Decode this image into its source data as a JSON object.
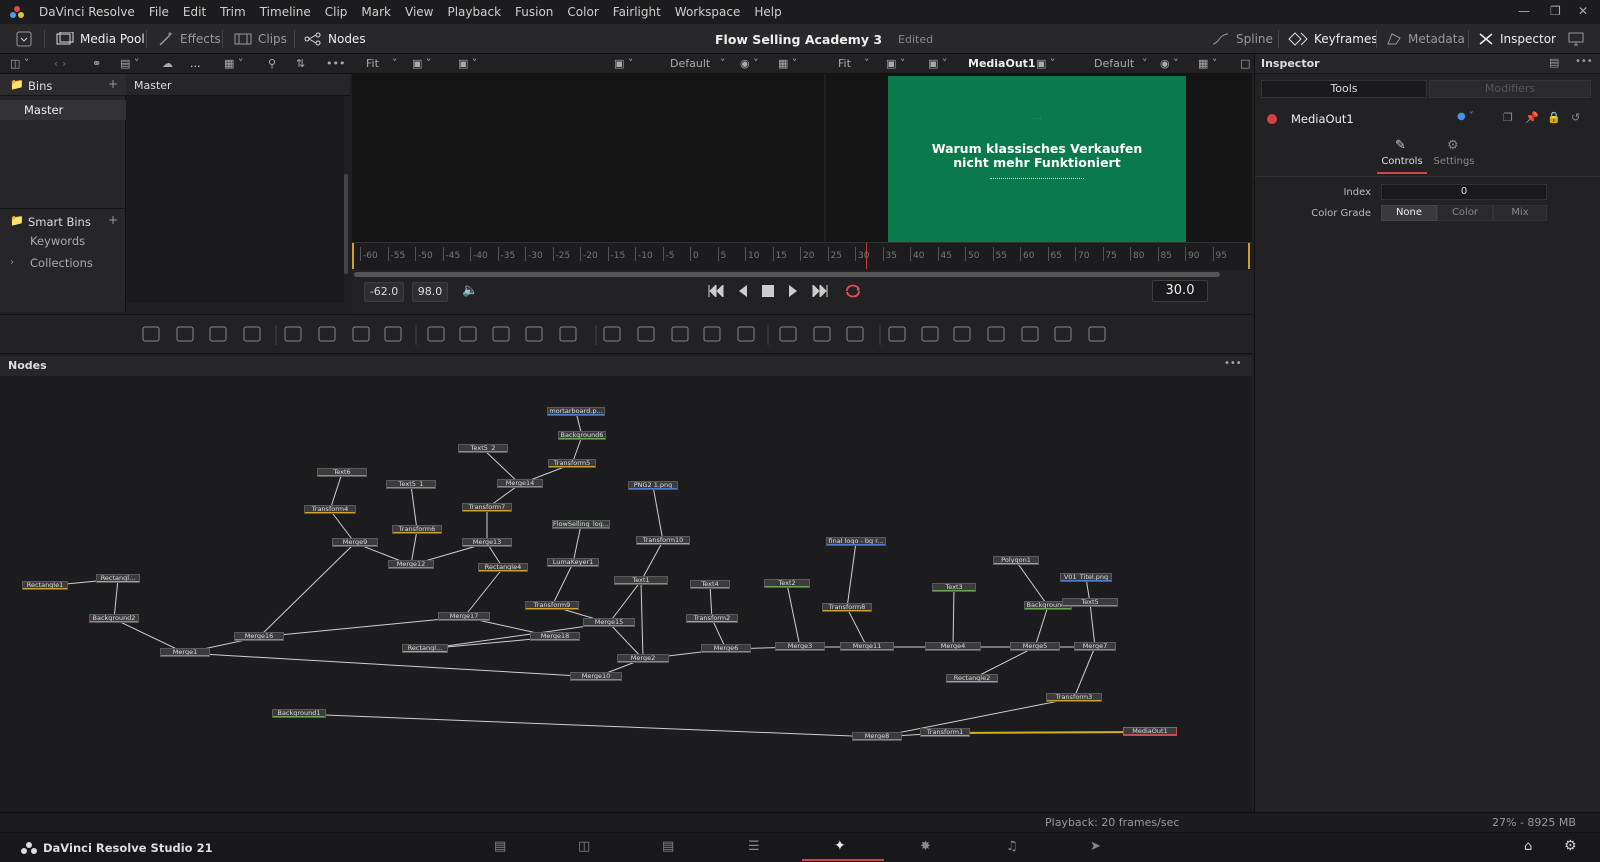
{
  "app": {
    "name": "DaVinci Resolve",
    "brand": "DaVinci Resolve Studio 21"
  },
  "menu": [
    "File",
    "Edit",
    "Trim",
    "Timeline",
    "Clip",
    "Mark",
    "View",
    "Playback",
    "Fusion",
    "Color",
    "Fairlight",
    "Workspace",
    "Help"
  ],
  "toolbar": {
    "media_pool": "Media Pool",
    "effects": "Effects",
    "clips": "Clips",
    "nodes": "Nodes",
    "project_title": "Flow Selling Academy 3",
    "project_status": "Edited",
    "spline": "Spline",
    "keyframes": "Keyframes",
    "metadata": "Metadata",
    "inspector": "Inspector"
  },
  "subbar": {
    "more": "...",
    "fit_left": "Fit",
    "default_left": "Default",
    "fit_right": "Fit",
    "viewer_name": "MediaOut1",
    "default_right": "Default"
  },
  "bins": {
    "title": "Bins",
    "master": "Master",
    "smart_bins": "Smart Bins",
    "keywords": "Keywords",
    "collections": "Collections",
    "pool_header": "Master"
  },
  "viewer": {
    "title_line1": "Warum klassisches Verkaufen",
    "title_line2": "nicht mehr Funktioniert",
    "accent": "#0b7a4b"
  },
  "ruler": {
    "ticks": [
      "-60",
      "-55",
      "-50",
      "-45",
      "-40",
      "-35",
      "-30",
      "-25",
      "-20",
      "-15",
      "-10",
      "-5",
      "0",
      "5",
      "10",
      "15",
      "20",
      "25",
      "30",
      "35",
      "40",
      "45",
      "50",
      "55",
      "60",
      "65",
      "70",
      "75",
      "80",
      "85",
      "90",
      "95"
    ]
  },
  "transport": {
    "start": "-62.0",
    "end": "98.0",
    "current": "30.0"
  },
  "nodes": {
    "header": "Nodes",
    "more": "•••",
    "list": [
      {
        "label": "mortarboard.p...",
        "bar": "#4a7fd0"
      },
      {
        "label": "Background6",
        "bar": "#6aa84f"
      },
      {
        "label": "Text5_2",
        "bar": "#6aa84f"
      },
      {
        "label": "Transform5",
        "bar": "#d4a030"
      },
      {
        "label": "Merge14",
        "bar": "#888888"
      },
      {
        "label": "Text6",
        "bar": "#6aa84f"
      },
      {
        "label": "Text5_1",
        "bar": "#6aa84f"
      },
      {
        "label": "Transform7",
        "bar": "#d4a030"
      },
      {
        "label": "PNG2 1.png",
        "bar": "#4a7fd0"
      },
      {
        "label": "Transform4",
        "bar": "#d4a030"
      },
      {
        "label": "Transform6",
        "bar": "#d4a030"
      },
      {
        "label": "FlowSelling_log...",
        "bar": "#4a7fd0"
      },
      {
        "label": "Merge9",
        "bar": "#888888"
      },
      {
        "label": "Merge13",
        "bar": "#888888"
      },
      {
        "label": "Transform10",
        "bar": "#d4a030"
      },
      {
        "label": "final logo - bg r...",
        "bar": "#4a7fd0"
      },
      {
        "label": "Merge12",
        "bar": "#888888"
      },
      {
        "label": "Rectangle4",
        "bar": "#d4a030"
      },
      {
        "label": "LumaKeyer1",
        "bar": "#6aa84f"
      },
      {
        "label": "Polygon1",
        "bar": "#d4a030"
      },
      {
        "label": "Rectangle1",
        "bar": "#d4a030"
      },
      {
        "label": "Rectangl...",
        "bar": "#d4a030"
      },
      {
        "label": "Text1",
        "bar": "#6aa84f"
      },
      {
        "label": "Text4",
        "bar": "#6aa84f"
      },
      {
        "label": "Text2",
        "bar": "#6aa84f"
      },
      {
        "label": "Text3",
        "bar": "#6aa84f"
      },
      {
        "label": "V01_Titel.png",
        "bar": "#4a7fd0"
      },
      {
        "label": "Background2",
        "bar": "#6aa84f"
      },
      {
        "label": "Transform9",
        "bar": "#d4a030"
      },
      {
        "label": "Background3",
        "bar": "#6aa84f"
      },
      {
        "label": "Text5",
        "bar": "#6aa84f"
      },
      {
        "label": "Transform8",
        "bar": "#d4a030"
      },
      {
        "label": "Merge17",
        "bar": "#888888"
      },
      {
        "label": "Merge15",
        "bar": "#888888"
      },
      {
        "label": "Transform2",
        "bar": "#d4a030"
      },
      {
        "label": "Merge16",
        "bar": "#888888"
      },
      {
        "label": "Merge18",
        "bar": "#888888"
      },
      {
        "label": "Merge6",
        "bar": "#888888"
      },
      {
        "label": "Merge3",
        "bar": "#888888"
      },
      {
        "label": "Merge11",
        "bar": "#888888"
      },
      {
        "label": "Merge4",
        "bar": "#888888"
      },
      {
        "label": "Merge5",
        "bar": "#888888"
      },
      {
        "label": "Merge7",
        "bar": "#888888"
      },
      {
        "label": "Rectangl...",
        "bar": "#d4a030"
      },
      {
        "label": "Merge1",
        "bar": "#888888"
      },
      {
        "label": "Merge2",
        "bar": "#888888"
      },
      {
        "label": "Merge10",
        "bar": "#888888"
      },
      {
        "label": "Rectangle2",
        "bar": "#d4a030"
      },
      {
        "label": "Transform3",
        "bar": "#d4a030"
      },
      {
        "label": "Background1",
        "bar": "#6aa84f"
      },
      {
        "label": "Merge8",
        "bar": "#888888"
      },
      {
        "label": "Transform1",
        "bar": "#d4a030"
      },
      {
        "label": "MediaOut1",
        "bar": "#c05050"
      }
    ]
  },
  "inspector": {
    "title": "Inspector",
    "tab_tools": "Tools",
    "tab_modifiers": "Modifiers",
    "node_name": "MediaOut1",
    "controls": "Controls",
    "settings": "Settings",
    "index_label": "Index",
    "index_value": "0",
    "color_grade_label": "Color Grade",
    "cg_none": "None",
    "cg_color": "Color",
    "cg_mix": "Mix"
  },
  "status": {
    "playback": "Playback: 20 frames/sec",
    "memory": "27% - 8925 MB"
  }
}
